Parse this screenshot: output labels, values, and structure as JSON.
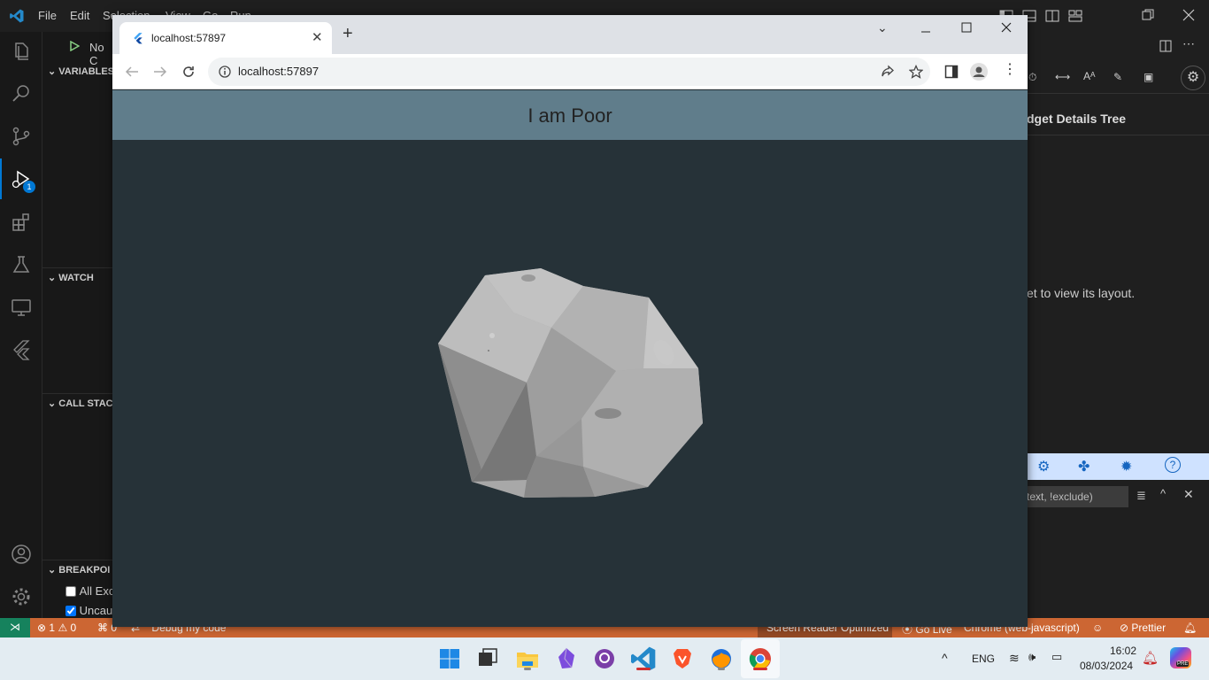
{
  "vscode": {
    "menu": [
      "File",
      "Edit",
      "Selection",
      "View",
      "Go",
      "Run"
    ],
    "debug_config": "No C",
    "sections": {
      "variables": "VARIABLES",
      "watch": "WATCH",
      "call_stack": "CALL STACK",
      "breakpoints": "BREAKPOI"
    },
    "breakpoints": [
      {
        "label": "All Exc",
        "checked": false
      },
      {
        "label": "Uncau",
        "checked": true
      }
    ],
    "debug_badge": "1",
    "right_panel": {
      "title": "dget Details Tree",
      "message": "et to view its layout.",
      "filter_placeholder": "text, !exclude)"
    },
    "status": {
      "errors": "1",
      "warnings": "0",
      "ports": "0",
      "debug": "Debug my code",
      "screen_reader": "Screen Reader Optimized",
      "go_live": "Go Live",
      "chrome": "Chrome (web-javascript)",
      "prettier": "Prettier"
    }
  },
  "browser": {
    "tab_title": "localhost:57897",
    "url": "localhost:57897",
    "app_title": "I am Poor"
  },
  "taskbar": {
    "lang": "ENG",
    "time": "16:02",
    "date": "08/03/2024"
  },
  "colors": {
    "appbar": "#607d8b",
    "background": "#263238",
    "status_bar": "#cc6633"
  }
}
